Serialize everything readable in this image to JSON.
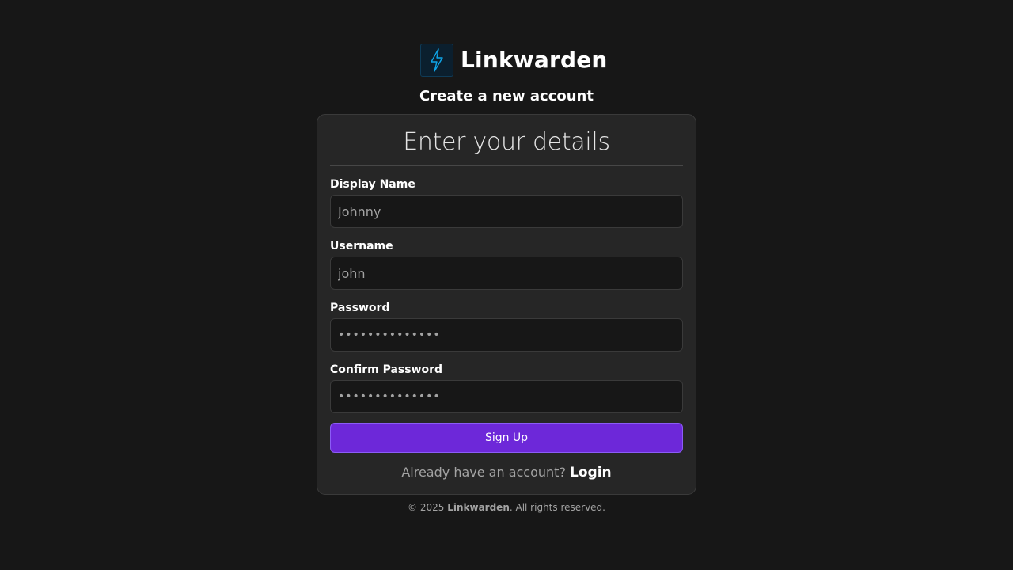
{
  "brand": {
    "name": "Linkwarden",
    "logo_icon": "lightning-bolt-icon",
    "logo_color": "#0ea5e9"
  },
  "subtitle": "Create a new account",
  "card": {
    "title": "Enter your details",
    "fields": [
      {
        "label": "Display Name",
        "value": "Johnny",
        "type": "text"
      },
      {
        "label": "Username",
        "value": "john",
        "type": "text"
      },
      {
        "label": "Password",
        "value": "••••••••••••••",
        "type": "password"
      },
      {
        "label": "Confirm Password",
        "value": "••••••••••••••",
        "type": "password"
      }
    ],
    "submit_label": "Sign Up",
    "login_prompt": "Already have an account?",
    "login_link": "Login"
  },
  "footer": {
    "copyright": "© 2025",
    "brand": "Linkwarden",
    "rights": ". All rights reserved."
  },
  "colors": {
    "background": "#171717",
    "card": "#262626",
    "accent": "#6d28d9"
  }
}
